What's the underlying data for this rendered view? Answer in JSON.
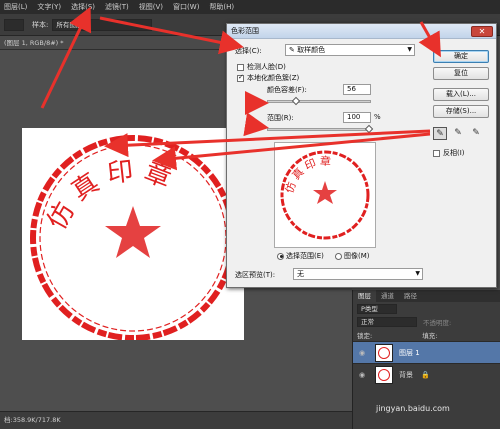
{
  "menubar": {
    "items": [
      "图层(L)",
      "文字(Y)",
      "选择(S)",
      "滤镜(T)",
      "视图(V)",
      "窗口(W)",
      "帮助(H)"
    ]
  },
  "options": {
    "sample_label": "样本:",
    "sample_value": "所有图层"
  },
  "doc_tab": {
    "label": "(图层 1, RGB/8#) *"
  },
  "status": {
    "text": "档:358.9K/717.8K"
  },
  "dialog": {
    "title": "色彩范围",
    "select_label": "选择(C):",
    "select_value": "取样颜色",
    "detect_faces_label": "检测人脸(D)",
    "localized_label": "本地化颜色簇(Z)",
    "fuzziness_label": "颜色容差(F):",
    "fuzziness_value": "56",
    "fuzziness_level": 0.28,
    "range_label": "范围(R):",
    "range_value": "100",
    "range_unit": "%",
    "range_level": 1.0,
    "radio_selection": "选择范围(E)",
    "radio_image": "图像(M)",
    "preview_label": "选区预览(T):",
    "preview_value": "无",
    "ok_label": "确定",
    "reset_label": "复位",
    "load_label": "载入(L)...",
    "save_label": "存储(S)...",
    "invert_label": "反相(I)",
    "close_glyph": "✕"
  },
  "stamp": {
    "text": "仿真印章",
    "color": "#e02020"
  },
  "layers": {
    "tabs": [
      "图层",
      "通道",
      "路径"
    ],
    "kind_label": "P类型",
    "blend_mode": "正常",
    "opacity_label": "不透明度:",
    "lock_label": "锁定:",
    "fill_label": "填充:",
    "layer1_name": "图层 1",
    "bg_name": "背景"
  },
  "watermark": {
    "text": "jingyan.baidu.com"
  }
}
